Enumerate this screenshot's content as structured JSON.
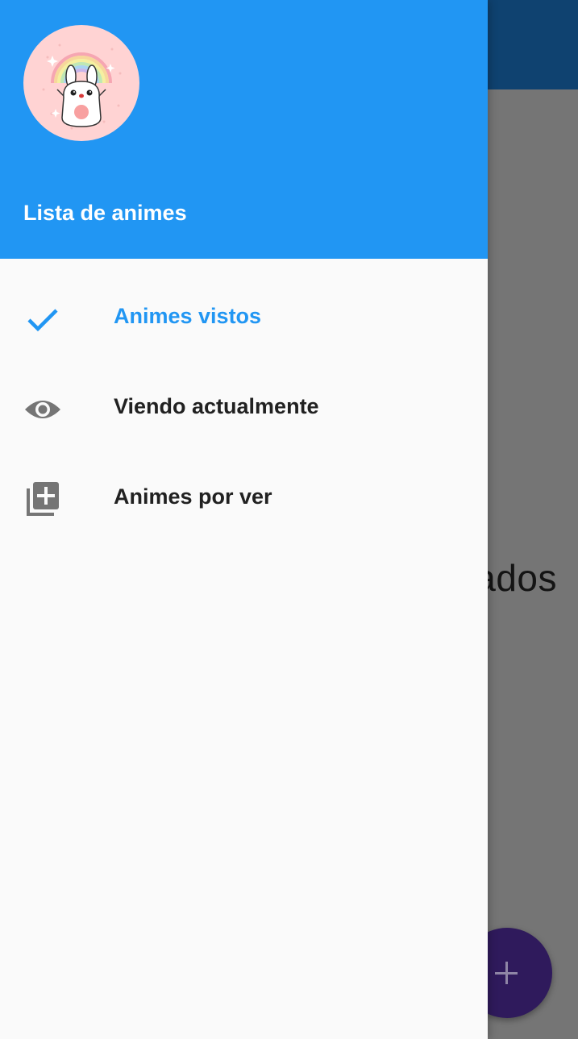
{
  "background": {
    "partial_text": "ados",
    "fab_icon": "plus-icon"
  },
  "drawer": {
    "header": {
      "title": "Lista de animes",
      "avatar": "bunny-rainbow-avatar"
    },
    "items": [
      {
        "label": "Animes vistos",
        "icon": "check-icon",
        "selected": true
      },
      {
        "label": "Viendo actualmente",
        "icon": "eye-icon",
        "selected": false
      },
      {
        "label": "Animes por ver",
        "icon": "library-add-icon",
        "selected": false
      }
    ]
  },
  "colors": {
    "primary": "#2196f3",
    "scrim_body": "#757575",
    "scrim_appbar": "#0f4270",
    "drawer_bg": "#fafafa",
    "icon_grey": "#757575",
    "fab": "#2f1a5c"
  }
}
